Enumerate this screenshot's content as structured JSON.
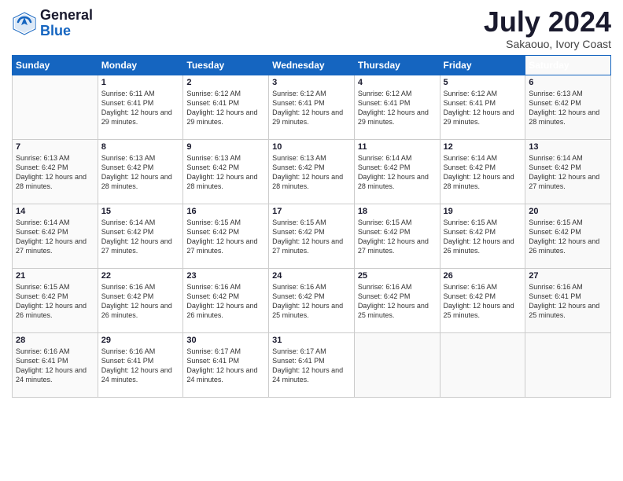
{
  "logo": {
    "general": "General",
    "blue": "Blue"
  },
  "title": "July 2024",
  "location": "Sakaouo, Ivory Coast",
  "days_of_week": [
    "Sunday",
    "Monday",
    "Tuesday",
    "Wednesday",
    "Thursday",
    "Friday",
    "Saturday"
  ],
  "weeks": [
    [
      {
        "day": "",
        "sunrise": "",
        "sunset": "",
        "daylight": ""
      },
      {
        "day": "1",
        "sunrise": "Sunrise: 6:11 AM",
        "sunset": "Sunset: 6:41 PM",
        "daylight": "Daylight: 12 hours and 29 minutes."
      },
      {
        "day": "2",
        "sunrise": "Sunrise: 6:12 AM",
        "sunset": "Sunset: 6:41 PM",
        "daylight": "Daylight: 12 hours and 29 minutes."
      },
      {
        "day": "3",
        "sunrise": "Sunrise: 6:12 AM",
        "sunset": "Sunset: 6:41 PM",
        "daylight": "Daylight: 12 hours and 29 minutes."
      },
      {
        "day": "4",
        "sunrise": "Sunrise: 6:12 AM",
        "sunset": "Sunset: 6:41 PM",
        "daylight": "Daylight: 12 hours and 29 minutes."
      },
      {
        "day": "5",
        "sunrise": "Sunrise: 6:12 AM",
        "sunset": "Sunset: 6:41 PM",
        "daylight": "Daylight: 12 hours and 29 minutes."
      },
      {
        "day": "6",
        "sunrise": "Sunrise: 6:13 AM",
        "sunset": "Sunset: 6:42 PM",
        "daylight": "Daylight: 12 hours and 28 minutes."
      }
    ],
    [
      {
        "day": "7",
        "sunrise": "Sunrise: 6:13 AM",
        "sunset": "Sunset: 6:42 PM",
        "daylight": "Daylight: 12 hours and 28 minutes."
      },
      {
        "day": "8",
        "sunrise": "Sunrise: 6:13 AM",
        "sunset": "Sunset: 6:42 PM",
        "daylight": "Daylight: 12 hours and 28 minutes."
      },
      {
        "day": "9",
        "sunrise": "Sunrise: 6:13 AM",
        "sunset": "Sunset: 6:42 PM",
        "daylight": "Daylight: 12 hours and 28 minutes."
      },
      {
        "day": "10",
        "sunrise": "Sunrise: 6:13 AM",
        "sunset": "Sunset: 6:42 PM",
        "daylight": "Daylight: 12 hours and 28 minutes."
      },
      {
        "day": "11",
        "sunrise": "Sunrise: 6:14 AM",
        "sunset": "Sunset: 6:42 PM",
        "daylight": "Daylight: 12 hours and 28 minutes."
      },
      {
        "day": "12",
        "sunrise": "Sunrise: 6:14 AM",
        "sunset": "Sunset: 6:42 PM",
        "daylight": "Daylight: 12 hours and 28 minutes."
      },
      {
        "day": "13",
        "sunrise": "Sunrise: 6:14 AM",
        "sunset": "Sunset: 6:42 PM",
        "daylight": "Daylight: 12 hours and 27 minutes."
      }
    ],
    [
      {
        "day": "14",
        "sunrise": "Sunrise: 6:14 AM",
        "sunset": "Sunset: 6:42 PM",
        "daylight": "Daylight: 12 hours and 27 minutes."
      },
      {
        "day": "15",
        "sunrise": "Sunrise: 6:14 AM",
        "sunset": "Sunset: 6:42 PM",
        "daylight": "Daylight: 12 hours and 27 minutes."
      },
      {
        "day": "16",
        "sunrise": "Sunrise: 6:15 AM",
        "sunset": "Sunset: 6:42 PM",
        "daylight": "Daylight: 12 hours and 27 minutes."
      },
      {
        "day": "17",
        "sunrise": "Sunrise: 6:15 AM",
        "sunset": "Sunset: 6:42 PM",
        "daylight": "Daylight: 12 hours and 27 minutes."
      },
      {
        "day": "18",
        "sunrise": "Sunrise: 6:15 AM",
        "sunset": "Sunset: 6:42 PM",
        "daylight": "Daylight: 12 hours and 27 minutes."
      },
      {
        "day": "19",
        "sunrise": "Sunrise: 6:15 AM",
        "sunset": "Sunset: 6:42 PM",
        "daylight": "Daylight: 12 hours and 26 minutes."
      },
      {
        "day": "20",
        "sunrise": "Sunrise: 6:15 AM",
        "sunset": "Sunset: 6:42 PM",
        "daylight": "Daylight: 12 hours and 26 minutes."
      }
    ],
    [
      {
        "day": "21",
        "sunrise": "Sunrise: 6:15 AM",
        "sunset": "Sunset: 6:42 PM",
        "daylight": "Daylight: 12 hours and 26 minutes."
      },
      {
        "day": "22",
        "sunrise": "Sunrise: 6:16 AM",
        "sunset": "Sunset: 6:42 PM",
        "daylight": "Daylight: 12 hours and 26 minutes."
      },
      {
        "day": "23",
        "sunrise": "Sunrise: 6:16 AM",
        "sunset": "Sunset: 6:42 PM",
        "daylight": "Daylight: 12 hours and 26 minutes."
      },
      {
        "day": "24",
        "sunrise": "Sunrise: 6:16 AM",
        "sunset": "Sunset: 6:42 PM",
        "daylight": "Daylight: 12 hours and 25 minutes."
      },
      {
        "day": "25",
        "sunrise": "Sunrise: 6:16 AM",
        "sunset": "Sunset: 6:42 PM",
        "daylight": "Daylight: 12 hours and 25 minutes."
      },
      {
        "day": "26",
        "sunrise": "Sunrise: 6:16 AM",
        "sunset": "Sunset: 6:42 PM",
        "daylight": "Daylight: 12 hours and 25 minutes."
      },
      {
        "day": "27",
        "sunrise": "Sunrise: 6:16 AM",
        "sunset": "Sunset: 6:41 PM",
        "daylight": "Daylight: 12 hours and 25 minutes."
      }
    ],
    [
      {
        "day": "28",
        "sunrise": "Sunrise: 6:16 AM",
        "sunset": "Sunset: 6:41 PM",
        "daylight": "Daylight: 12 hours and 24 minutes."
      },
      {
        "day": "29",
        "sunrise": "Sunrise: 6:16 AM",
        "sunset": "Sunset: 6:41 PM",
        "daylight": "Daylight: 12 hours and 24 minutes."
      },
      {
        "day": "30",
        "sunrise": "Sunrise: 6:17 AM",
        "sunset": "Sunset: 6:41 PM",
        "daylight": "Daylight: 12 hours and 24 minutes."
      },
      {
        "day": "31",
        "sunrise": "Sunrise: 6:17 AM",
        "sunset": "Sunset: 6:41 PM",
        "daylight": "Daylight: 12 hours and 24 minutes."
      },
      {
        "day": "",
        "sunrise": "",
        "sunset": "",
        "daylight": ""
      },
      {
        "day": "",
        "sunrise": "",
        "sunset": "",
        "daylight": ""
      },
      {
        "day": "",
        "sunrise": "",
        "sunset": "",
        "daylight": ""
      }
    ]
  ]
}
